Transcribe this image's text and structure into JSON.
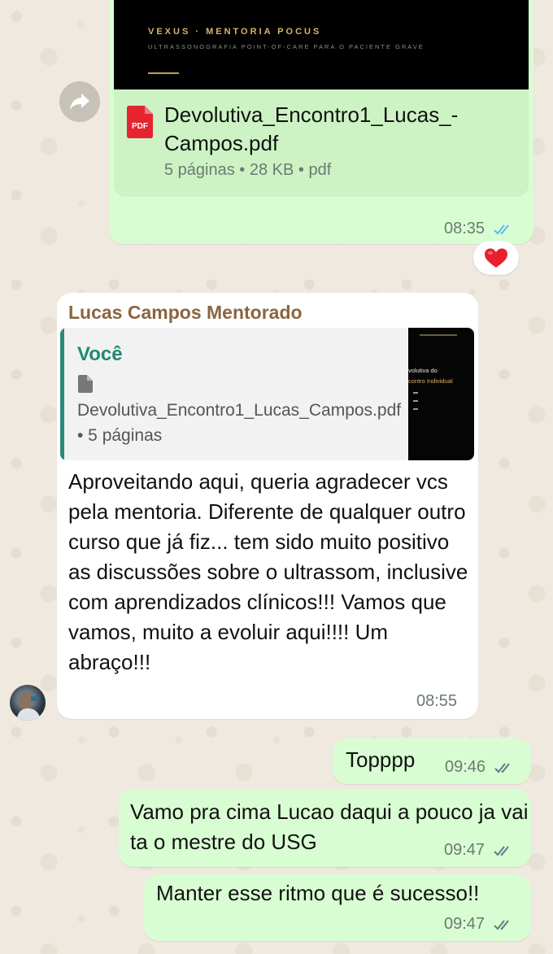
{
  "document_message": {
    "preview_brand": "VEXUS · MENTORIA POCUS",
    "preview_subtitle": "ULTRASSONOGRAFIA POINT-OF-CARE PARA O PACIENTE GRAVE",
    "file_icon_label": "PDF",
    "file_name": "Devolutiva_Encontro1_Lucas_-Campos.pdf",
    "file_meta": "5 páginas • 28 KB • pdf",
    "time": "08:35",
    "status": "read",
    "reaction": "❤️",
    "forward_icon": "forward-arrow-icon"
  },
  "incoming_message": {
    "sender": "Lucas Campos Mentorado",
    "quote": {
      "author": "Você",
      "file_name": "Devolutiva_Encontro1_Lucas_Campos.pdf • 5 páginas",
      "thumb_title": "volutiva do",
      "thumb_subtitle": "contro Individual"
    },
    "text": "Aproveitando aqui, queria agradecer vcs pela mentoria. Diferente de qualquer outro curso que já fiz... tem sido muito positivo as discussões sobre o ultrassom, inclusive com aprendizados clínicos!!! Vamos que vamos, muito a evoluir aqui!!!! Um abraço!!!",
    "time": "08:55"
  },
  "outgoing_messages": [
    {
      "text": "Topppp",
      "time": "09:46",
      "status": "delivered"
    },
    {
      "text": "Vamo pra cima Lucao daqui a pouco ja vai ta o mestre do USG",
      "time": "09:47",
      "status": "delivered"
    },
    {
      "text": "Manter esse ritmo que é sucesso!!",
      "time": "09:47",
      "status": "delivered"
    }
  ],
  "colors": {
    "outgoing_bubble": "#d9fdd3",
    "incoming_bubble": "#ffffff",
    "read_ticks": "#53bdeb",
    "delivered_ticks": "#667781",
    "sender_name": "#8a6540",
    "quote_author": "#1f8a72"
  }
}
